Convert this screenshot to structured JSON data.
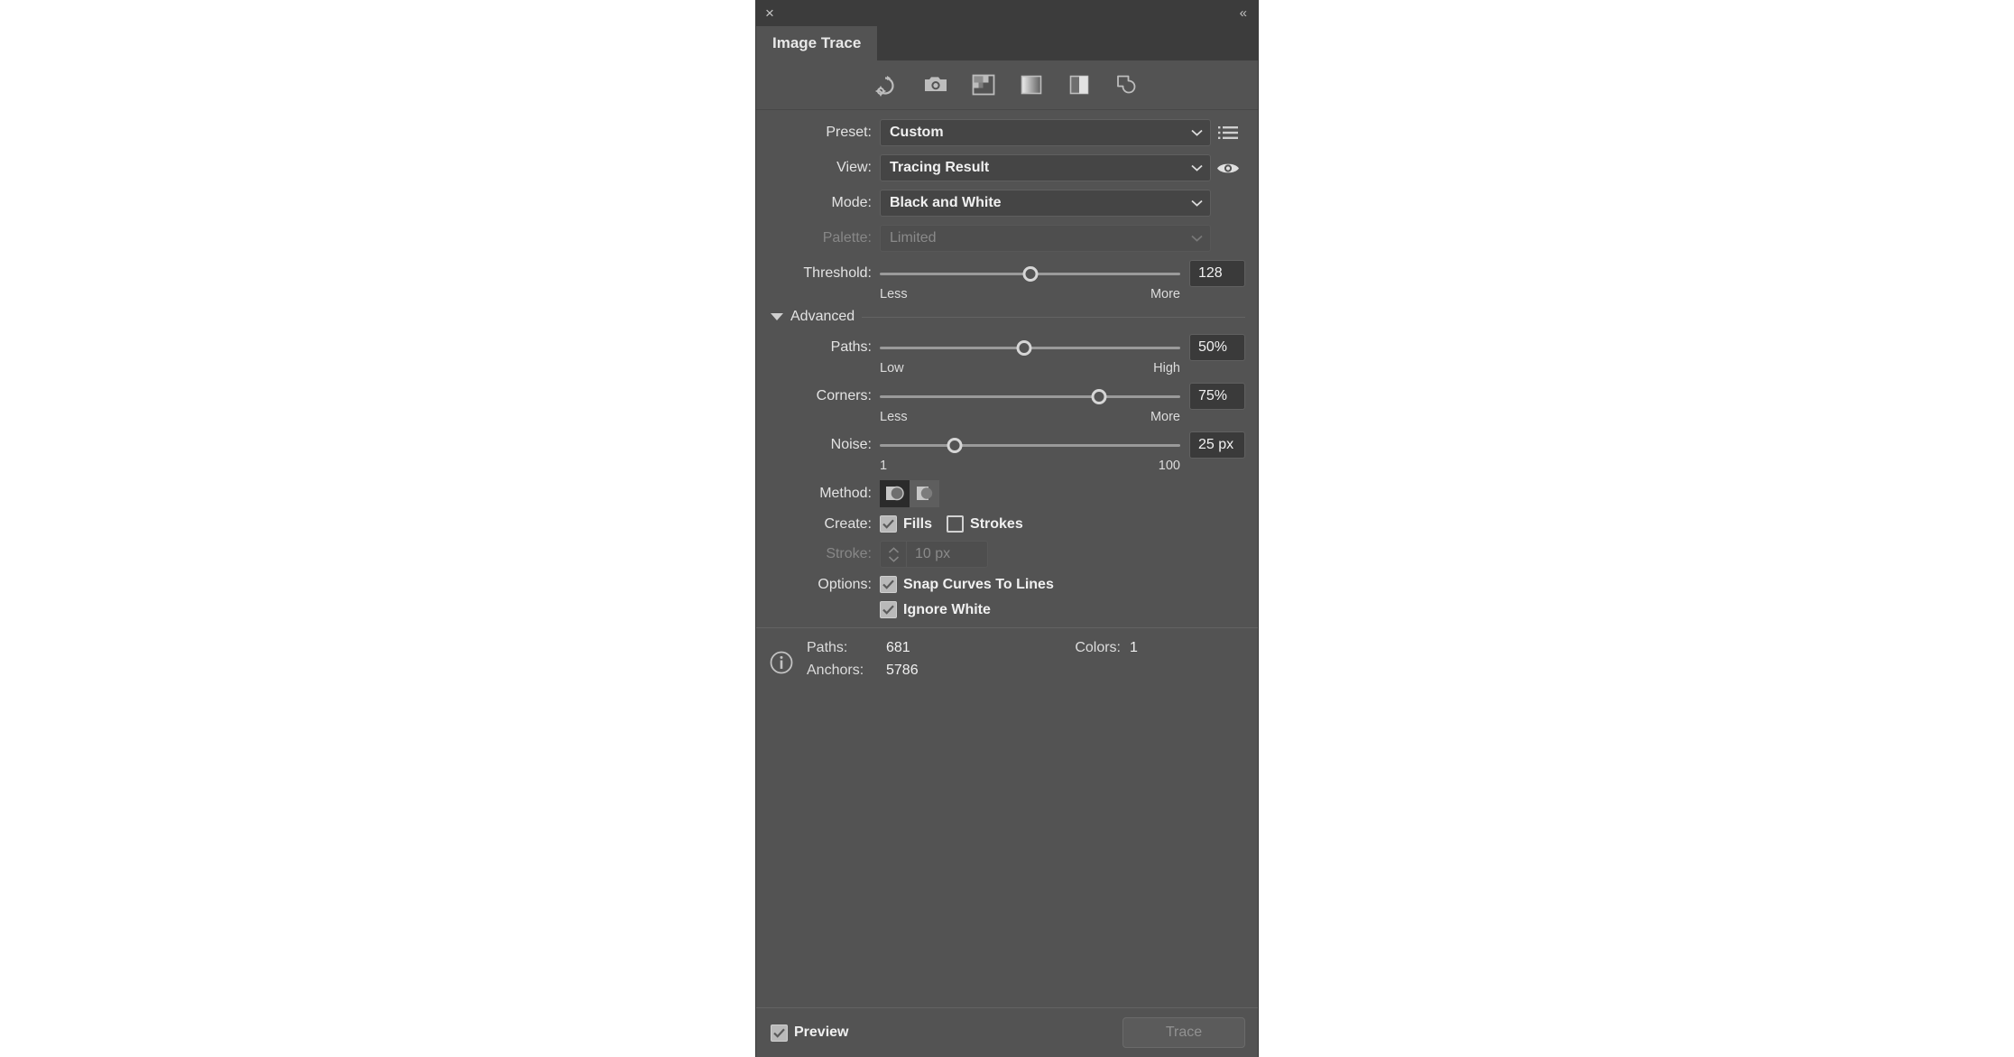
{
  "titlebar": {
    "close": "×",
    "collapse": "«"
  },
  "tab": {
    "label": "Image Trace"
  },
  "preset_icons": [
    {
      "name": "auto-color-icon",
      "title": "Auto-Color"
    },
    {
      "name": "high-color-photo-icon",
      "title": "High Color"
    },
    {
      "name": "limited-color-icon",
      "title": "Limited Color"
    },
    {
      "name": "grayscale-icon",
      "title": "Grayscale"
    },
    {
      "name": "black-and-white-icon",
      "title": "Black and White"
    },
    {
      "name": "outline-icon",
      "title": "Outline"
    }
  ],
  "fields": {
    "preset": {
      "label": "Preset:",
      "value": "Custom"
    },
    "view": {
      "label": "View:",
      "value": "Tracing Result"
    },
    "mode": {
      "label": "Mode:",
      "value": "Black and White"
    },
    "palette": {
      "label": "Palette:",
      "value": "Limited",
      "disabled": true
    }
  },
  "sliders": {
    "threshold": {
      "label": "Threshold:",
      "value": "128",
      "percent": 50,
      "min_label": "Less",
      "max_label": "More"
    },
    "paths": {
      "label": "Paths:",
      "value": "50%",
      "percent": 48,
      "min_label": "Low",
      "max_label": "High"
    },
    "corners": {
      "label": "Corners:",
      "value": "75%",
      "percent": 73,
      "min_label": "Less",
      "max_label": "More"
    },
    "noise": {
      "label": "Noise:",
      "value": "25 px",
      "percent": 25,
      "min_label": "1",
      "max_label": "100"
    }
  },
  "advanced": {
    "label": "Advanced"
  },
  "method": {
    "label": "Method:",
    "selected_index": 0,
    "options": [
      "abutting",
      "overlapping"
    ]
  },
  "create": {
    "label": "Create:",
    "fills": {
      "label": "Fills",
      "checked": true
    },
    "strokes": {
      "label": "Strokes",
      "checked": false
    }
  },
  "stroke": {
    "label": "Stroke:",
    "value": "10 px",
    "disabled": true
  },
  "options": {
    "label": "Options:",
    "snap": {
      "label": "Snap Curves To Lines",
      "checked": true
    },
    "ignore_white": {
      "label": "Ignore White",
      "checked": true
    }
  },
  "info": {
    "paths_label": "Paths:",
    "paths_value": "681",
    "colors_label": "Colors:",
    "colors_value": "1",
    "anchors_label": "Anchors:",
    "anchors_value": "5786"
  },
  "footer": {
    "preview_label": "Preview",
    "preview_checked": true,
    "trace_label": "Trace",
    "trace_disabled": true
  },
  "colors": {
    "panel_bg": "#535353",
    "chrome_bg": "#3c3c3c",
    "field_bg": "#454545",
    "input_bg": "#3a3a3a",
    "text": "#f0f0f0",
    "text_dim": "#8a8a8a",
    "track": "#9a9a9a"
  }
}
